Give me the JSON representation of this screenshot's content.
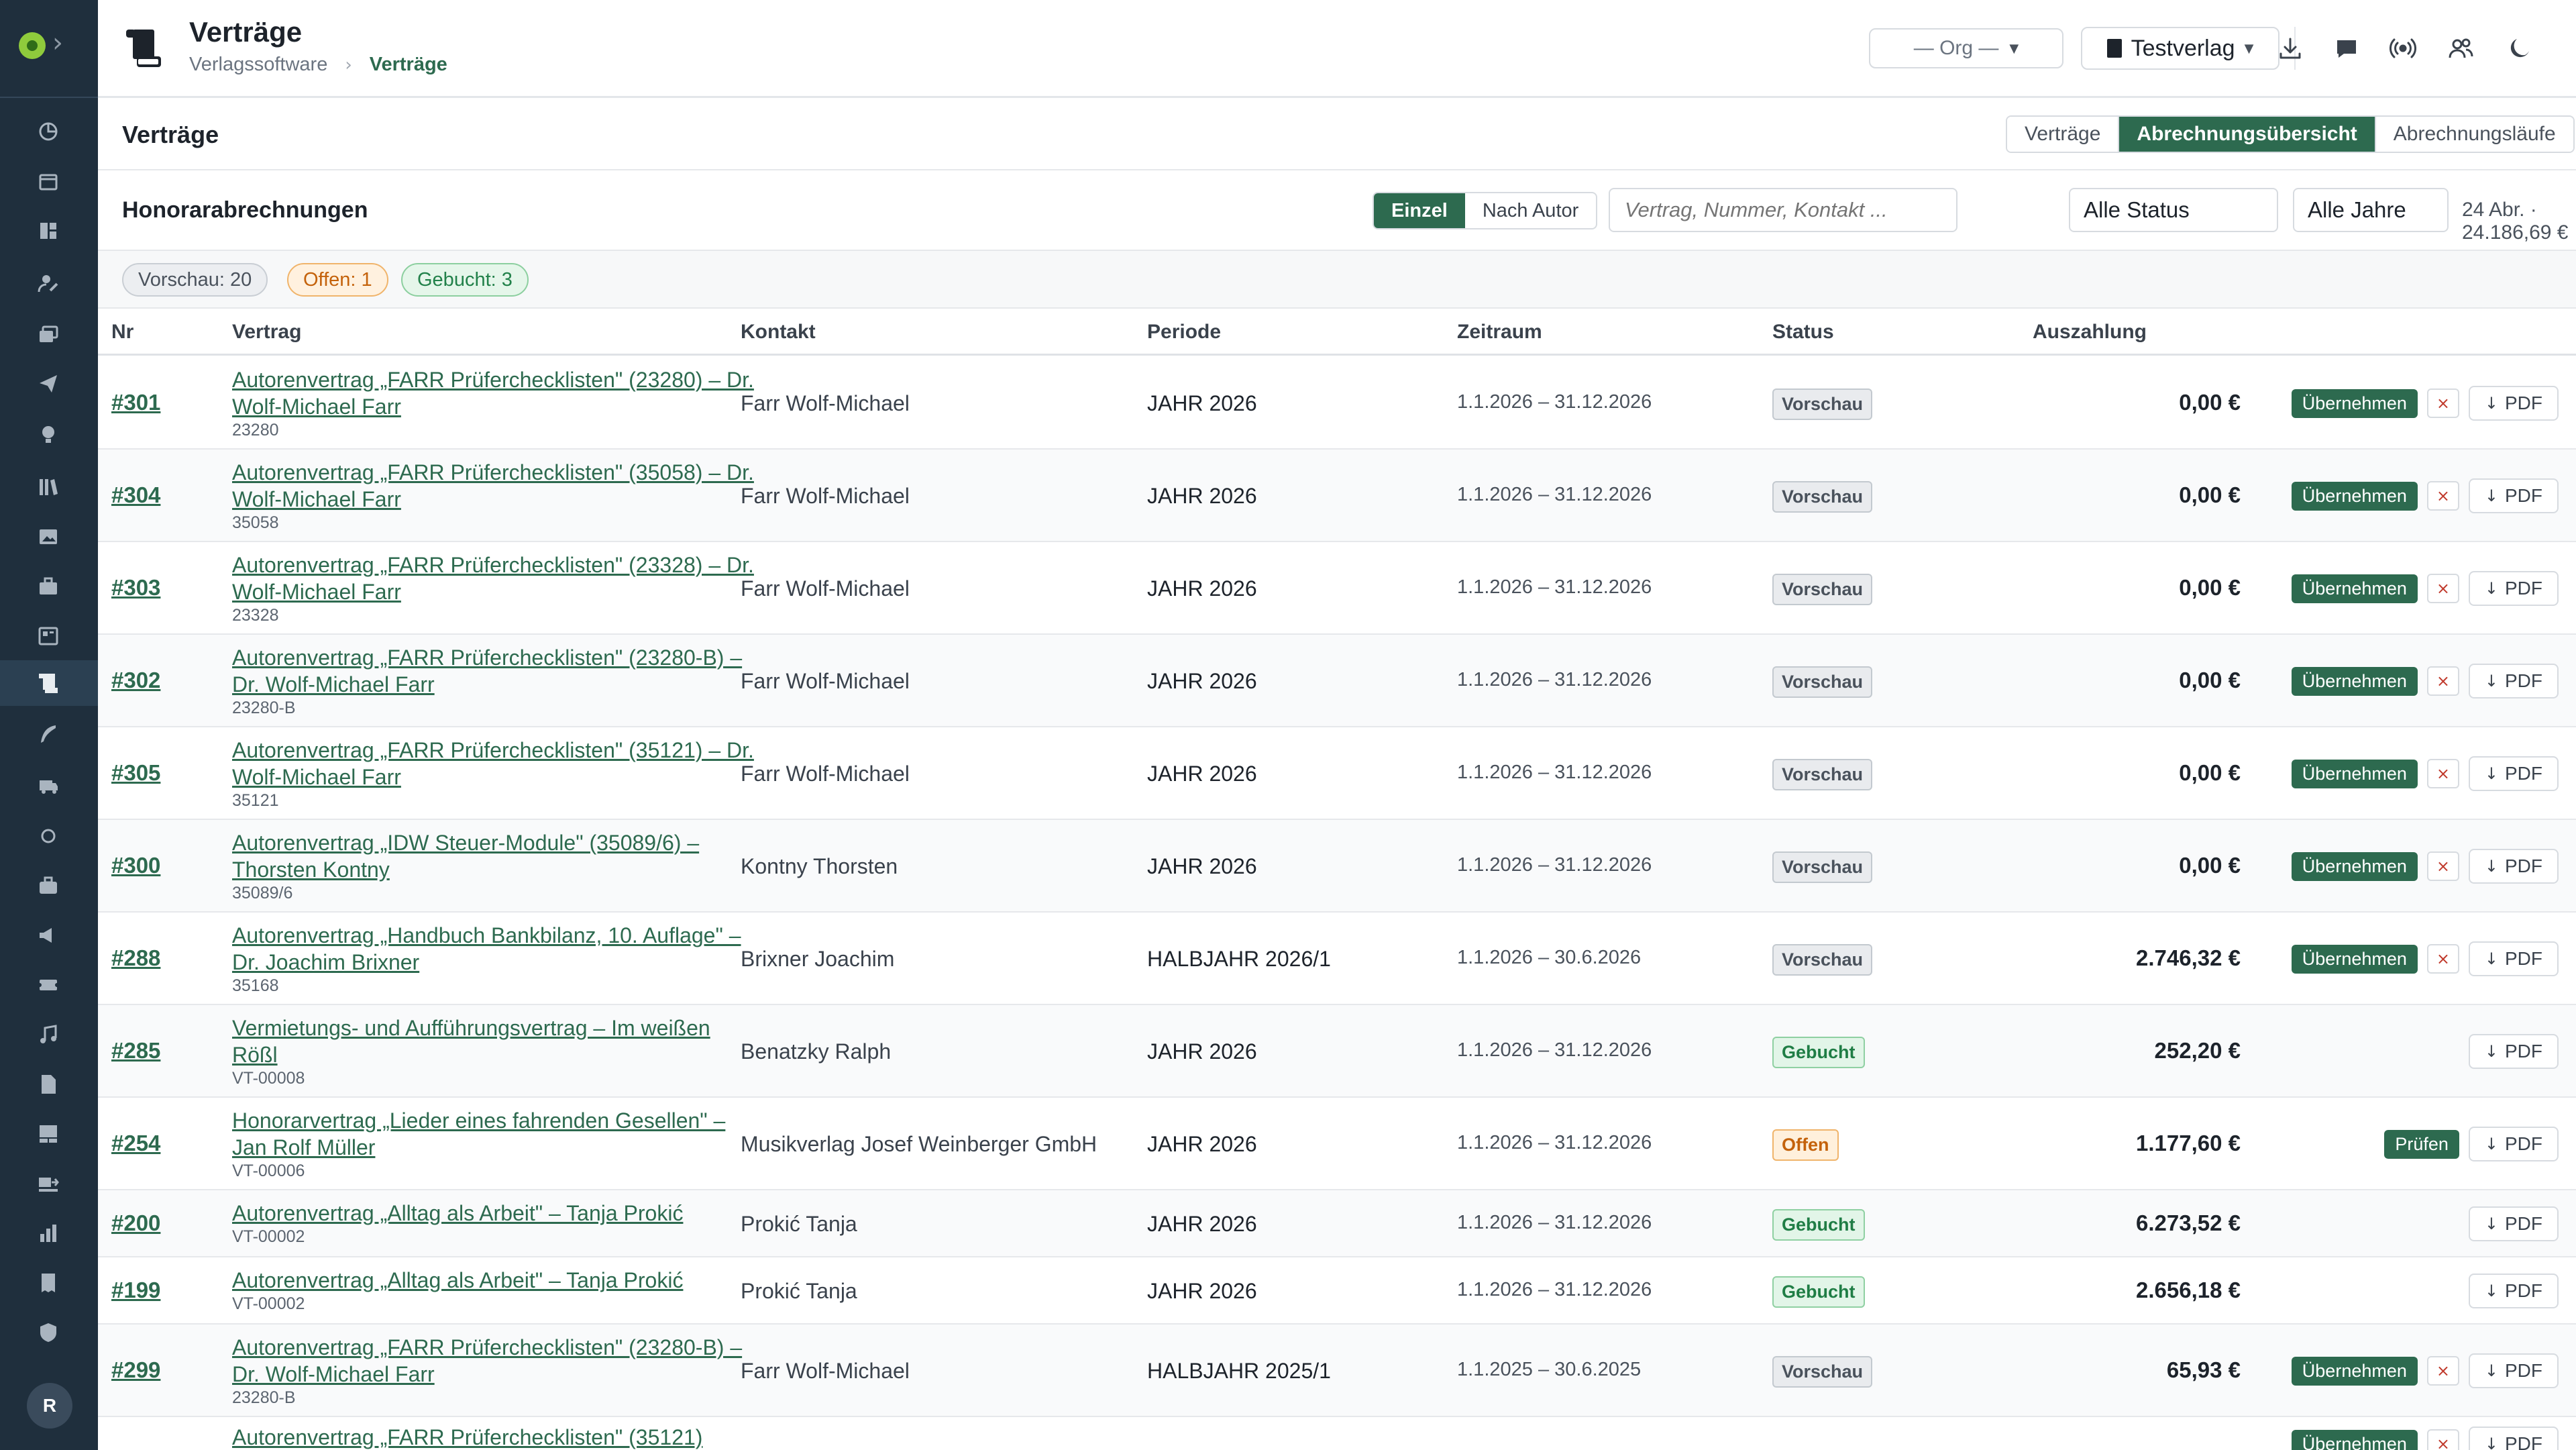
{
  "sidebar": {
    "expand_icon": "chevron-right-icon",
    "avatar_initial": "R",
    "items": [
      {
        "icon": "pie-chart-icon"
      },
      {
        "icon": "calendar-icon"
      },
      {
        "icon": "dashboard-icon"
      },
      {
        "icon": "user-edit-icon"
      },
      {
        "icon": "stack-icon"
      },
      {
        "icon": "paper-plane-icon"
      },
      {
        "icon": "lightbulb-icon"
      },
      {
        "icon": "library-icon"
      },
      {
        "icon": "image-icon"
      },
      {
        "icon": "briefcase-icon"
      },
      {
        "icon": "board-icon"
      },
      {
        "icon": "scroll-icon",
        "active": true
      },
      {
        "icon": "feather-icon"
      },
      {
        "icon": "truck-icon"
      },
      {
        "icon": "circle-icon"
      },
      {
        "icon": "suitcase-icon"
      },
      {
        "icon": "megaphone-icon"
      },
      {
        "icon": "ticket-icon"
      },
      {
        "icon": "music-icon"
      },
      {
        "icon": "file-icon"
      },
      {
        "icon": "warehouse-icon"
      },
      {
        "icon": "truck-loading-icon"
      },
      {
        "icon": "bar-chart-icon"
      },
      {
        "icon": "receipt-icon"
      },
      {
        "icon": "shield-icon"
      }
    ]
  },
  "header": {
    "title": "Verträge",
    "breadcrumb": [
      "Verlagssoftware",
      "Verträge"
    ],
    "org_select": "— Org —",
    "publisher_select": "Testverlag",
    "icons": [
      "download-icon",
      "chat-icon",
      "broadcast-icon",
      "users-icon",
      "moon-icon"
    ]
  },
  "section": {
    "title": "Verträge",
    "tabs": [
      {
        "label": "Verträge",
        "active": false
      },
      {
        "label": "Abrechnungsübersicht",
        "active": true
      },
      {
        "label": "Abrechnungsläufe",
        "active": false
      }
    ]
  },
  "toolbar": {
    "title": "Honorarabrechnungen",
    "mode_single": "Einzel",
    "mode_author": "Nach Autor",
    "search_placeholder": "Vertrag, Nummer, Kontakt ...",
    "status_filter": "Alle Status",
    "year_filter": "Alle Jahre",
    "summary": "24 Abr. · 24.186,69 €"
  },
  "filter_pills": {
    "preview": "Vorschau: 20",
    "open": "Offen: 1",
    "booked": "Gebucht: 3"
  },
  "table": {
    "columns": {
      "nr": "Nr",
      "vertrag": "Vertrag",
      "kontakt": "Kontakt",
      "periode": "Periode",
      "zeitraum": "Zeitraum",
      "status": "Status",
      "auszahlung": "Auszahlung"
    },
    "actions": {
      "accept": "Übernehmen",
      "check": "Prüfen",
      "pdf": "PDF",
      "delete": "×"
    },
    "rows": [
      {
        "nr": "#301",
        "vertrag": "Autorenvertrag „FARR Prüferchecklisten\" (23280) – Dr. Wolf-Michael Farr",
        "sub": "23280",
        "kontakt": "Farr Wolf-Michael",
        "periode": "JAHR 2026",
        "zeitraum": "1.1.2026 – 31.12.2026",
        "status": "Vorschau",
        "status_type": "vorschau",
        "amount": "0,00 €",
        "action": "accept"
      },
      {
        "nr": "#304",
        "vertrag": "Autorenvertrag „FARR Prüferchecklisten\" (35058) – Dr. Wolf-Michael Farr",
        "sub": "35058",
        "kontakt": "Farr Wolf-Michael",
        "periode": "JAHR 2026",
        "zeitraum": "1.1.2026 – 31.12.2026",
        "status": "Vorschau",
        "status_type": "vorschau",
        "amount": "0,00 €",
        "action": "accept"
      },
      {
        "nr": "#303",
        "vertrag": "Autorenvertrag „FARR Prüferchecklisten\" (23328) – Dr. Wolf-Michael Farr",
        "sub": "23328",
        "kontakt": "Farr Wolf-Michael",
        "periode": "JAHR 2026",
        "zeitraum": "1.1.2026 – 31.12.2026",
        "status": "Vorschau",
        "status_type": "vorschau",
        "amount": "0,00 €",
        "action": "accept"
      },
      {
        "nr": "#302",
        "vertrag": "Autorenvertrag „FARR Prüferchecklisten\" (23280-B) – Dr. Wolf-Michael Farr",
        "sub": "23280-B",
        "kontakt": "Farr Wolf-Michael",
        "periode": "JAHR 2026",
        "zeitraum": "1.1.2026 – 31.12.2026",
        "status": "Vorschau",
        "status_type": "vorschau",
        "amount": "0,00 €",
        "action": "accept"
      },
      {
        "nr": "#305",
        "vertrag": "Autorenvertrag „FARR Prüferchecklisten\" (35121) – Dr. Wolf-Michael Farr",
        "sub": "35121",
        "kontakt": "Farr Wolf-Michael",
        "periode": "JAHR 2026",
        "zeitraum": "1.1.2026 – 31.12.2026",
        "status": "Vorschau",
        "status_type": "vorschau",
        "amount": "0,00 €",
        "action": "accept"
      },
      {
        "nr": "#300",
        "vertrag": "Autorenvertrag „IDW Steuer-Module\" (35089/6) – Thorsten Kontny",
        "sub": "35089/6",
        "kontakt": "Kontny Thorsten",
        "periode": "JAHR 2026",
        "zeitraum": "1.1.2026 – 31.12.2026",
        "status": "Vorschau",
        "status_type": "vorschau",
        "amount": "0,00 €",
        "action": "accept"
      },
      {
        "nr": "#288",
        "vertrag": "Autorenvertrag „Handbuch Bankbilanz, 10. Auflage\" – Dr. Joachim Brixner",
        "sub": "35168",
        "kontakt": "Brixner Joachim",
        "periode": "HALBJAHR 2026/1",
        "zeitraum": "1.1.2026 – 30.6.2026",
        "status": "Vorschau",
        "status_type": "vorschau",
        "amount": "2.746,32 €",
        "action": "accept"
      },
      {
        "nr": "#285",
        "vertrag": "Vermietungs- und Aufführungsvertrag – Im weißen Rößl",
        "sub": "VT-00008",
        "kontakt": "Benatzky Ralph",
        "periode": "JAHR 2026",
        "zeitraum": "1.1.2026 – 31.12.2026",
        "status": "Gebucht",
        "status_type": "gebucht",
        "amount": "252,20 €",
        "action": "none"
      },
      {
        "nr": "#254",
        "vertrag": "Honorarvertrag „Lieder eines fahrenden Gesellen\" – Jan Rolf Müller",
        "sub": "VT-00006",
        "kontakt": "Musikverlag Josef Weinberger GmbH",
        "periode": "JAHR 2026",
        "zeitraum": "1.1.2026 – 31.12.2026",
        "status": "Offen",
        "status_type": "offen",
        "amount": "1.177,60 €",
        "action": "check"
      },
      {
        "nr": "#200",
        "vertrag": "Autorenvertrag „Alltag als Arbeit\" – Tanja Prokić",
        "sub": "VT-00002",
        "kontakt": "Prokić Tanja",
        "periode": "JAHR 2026",
        "zeitraum": "1.1.2026 – 31.12.2026",
        "status": "Gebucht",
        "status_type": "gebucht",
        "amount": "6.273,52 €",
        "action": "none"
      },
      {
        "nr": "#199",
        "vertrag": "Autorenvertrag „Alltag als Arbeit\" – Tanja Prokić",
        "sub": "VT-00002",
        "kontakt": "Prokić Tanja",
        "periode": "JAHR 2026",
        "zeitraum": "1.1.2026 – 31.12.2026",
        "status": "Gebucht",
        "status_type": "gebucht",
        "amount": "2.656,18 €",
        "action": "none"
      },
      {
        "nr": "#299",
        "vertrag": "Autorenvertrag „FARR Prüferchecklisten\" (23280-B) – Dr. Wolf-Michael Farr",
        "sub": "23280-B",
        "kontakt": "Farr Wolf-Michael",
        "periode": "HALBJAHR 2025/1",
        "zeitraum": "1.1.2025 – 30.6.2025",
        "status": "Vorschau",
        "status_type": "vorschau",
        "amount": "65,93 €",
        "action": "accept"
      },
      {
        "nr": "",
        "vertrag": "Autorenvertrag „FARR Prüferchecklisten\" (35121)",
        "sub": "",
        "kontakt": "",
        "periode": "",
        "zeitraum": "",
        "status": "",
        "status_type": "vorschau",
        "amount": "",
        "action": "accept"
      }
    ]
  }
}
